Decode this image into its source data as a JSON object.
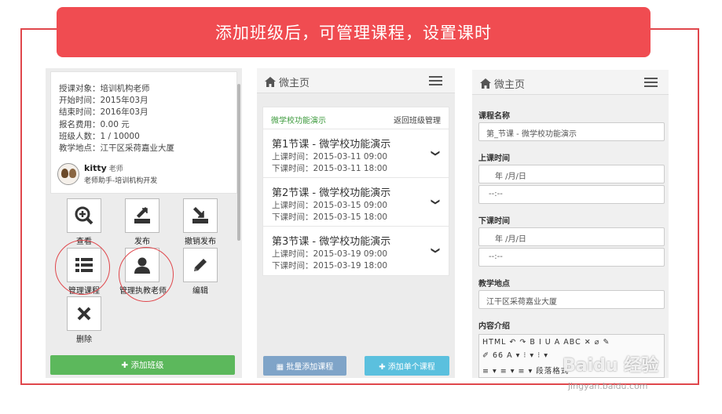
{
  "banner": {
    "text": "添加班级后，可管理课程，设置课时"
  },
  "panel1": {
    "info": [
      "授课对象：培训机构老师",
      "开始时间：2015年03月",
      "结束时间：2016年03月",
      "报名费用：0.00 元",
      "班级人数：1 / 10000",
      "教学地点：江干区采荷嘉业大厦"
    ],
    "teacher": {
      "name": "kitty",
      "role": "老师",
      "subtitle": "老师助手-培训机构开发"
    },
    "actions": [
      {
        "label": "查看",
        "icon": "zoom-in-icon"
      },
      {
        "label": "发布",
        "icon": "publish-icon"
      },
      {
        "label": "撤销发布",
        "icon": "unpublish-icon"
      },
      {
        "label": "管理课程",
        "icon": "list-icon"
      },
      {
        "label": "管理执教老师",
        "icon": "user-icon"
      },
      {
        "label": "编辑",
        "icon": "pencil-icon"
      },
      {
        "label": "删除",
        "icon": "close-icon"
      }
    ],
    "add_button": "✚ 添加班级"
  },
  "panel2": {
    "header_title": "微主页",
    "list_title": "微学校功能演示",
    "back_link": "返回班级管理",
    "courses": [
      {
        "title": "第1节课 - 微学校功能演示",
        "start": "上课时间：2015-03-11 09:00",
        "end": "下课时间：2015-03-11 18:00"
      },
      {
        "title": "第2节课 - 微学校功能演示",
        "start": "上课时间：2015-03-15 09:00",
        "end": "下课时间：2015-03-15 18:00"
      },
      {
        "title": "第3节课 - 微学校功能演示",
        "start": "上课时间：2015-03-19 09:00",
        "end": "下课时间：2015-03-19 18:00"
      }
    ],
    "batch_button": "▦ 批量添加课程",
    "single_button": "✚ 添加单个课程"
  },
  "panel3": {
    "header_title": "微主页",
    "course_name_label": "课程名称",
    "course_name_value": "第_节课 - 微学校功能演示",
    "start_label": "上课时间",
    "start_date": "年 /月/日",
    "start_time": "--:--",
    "end_label": "下课时间",
    "end_date": "年 /月/日",
    "end_time": "--:--",
    "location_label": "教学地点",
    "location_value": "江干区采荷嘉业大厦",
    "intro_label": "内容介绍",
    "toolbar_row1": "HTML ↶ ↷ B I U A ABC ✕ ⌀ ✎",
    "toolbar_row2": "✐ 66 A ▾ ⁝ ▾ ⁝ ▾",
    "toolbar_row3": "≡ ▾ ≡ ▾ ≡ ▾ 段落格式"
  },
  "watermark": {
    "main": "Baidu 经验",
    "sub": "jingyan.baidu.com"
  }
}
